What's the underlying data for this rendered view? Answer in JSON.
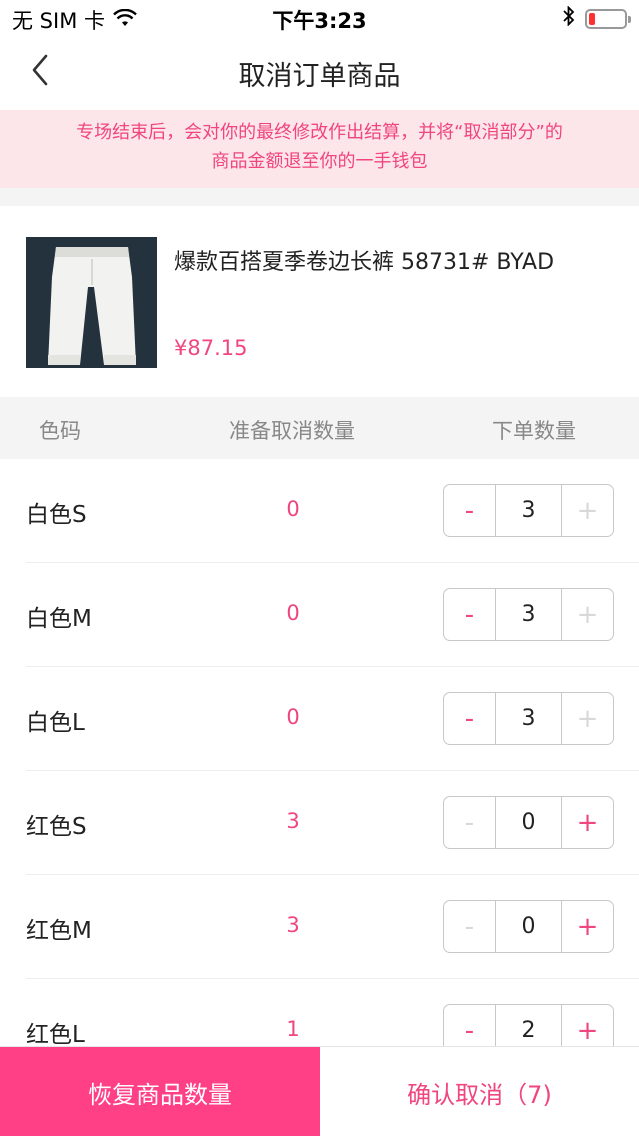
{
  "status_bar": {
    "carrier": "无 SIM 卡",
    "time": "下午3:23"
  },
  "nav": {
    "title": "取消订单商品"
  },
  "notice": {
    "line1": "专场结束后，会对你的最终修改作出结算，并将“取消部分”的",
    "line2": "商品金额退至你的一手钱包"
  },
  "product": {
    "name": "爆款百搭夏季卷边长裤 58731# BYAD",
    "price": "¥87.15"
  },
  "table": {
    "headers": {
      "color": "色码",
      "cancel": "准备取消数量",
      "order": "下单数量"
    },
    "rows": [
      {
        "label": "白色S",
        "cancel": "0",
        "qty": "3",
        "minus_enabled": true,
        "plus_enabled": false
      },
      {
        "label": "白色M",
        "cancel": "0",
        "qty": "3",
        "minus_enabled": true,
        "plus_enabled": false
      },
      {
        "label": "白色L",
        "cancel": "0",
        "qty": "3",
        "minus_enabled": true,
        "plus_enabled": false
      },
      {
        "label": "红色S",
        "cancel": "3",
        "qty": "0",
        "minus_enabled": false,
        "plus_enabled": true
      },
      {
        "label": "红色M",
        "cancel": "3",
        "qty": "0",
        "minus_enabled": false,
        "plus_enabled": true
      },
      {
        "label": "红色L",
        "cancel": "1",
        "qty": "2",
        "minus_enabled": true,
        "plus_enabled": true
      }
    ],
    "minus_symbol": "-",
    "plus_symbol": "+"
  },
  "bottom": {
    "restore_label": "恢复商品数量",
    "confirm_label": "确认取消（7)"
  },
  "colors": {
    "accent": "#f0457f",
    "primary_button": "#ff3f86",
    "notice_bg": "#fde6ea"
  },
  "icons": {
    "wifi": "wifi-icon",
    "bluetooth": "bluetooth-icon",
    "battery": "battery-icon",
    "back": "chevron-left-icon"
  }
}
